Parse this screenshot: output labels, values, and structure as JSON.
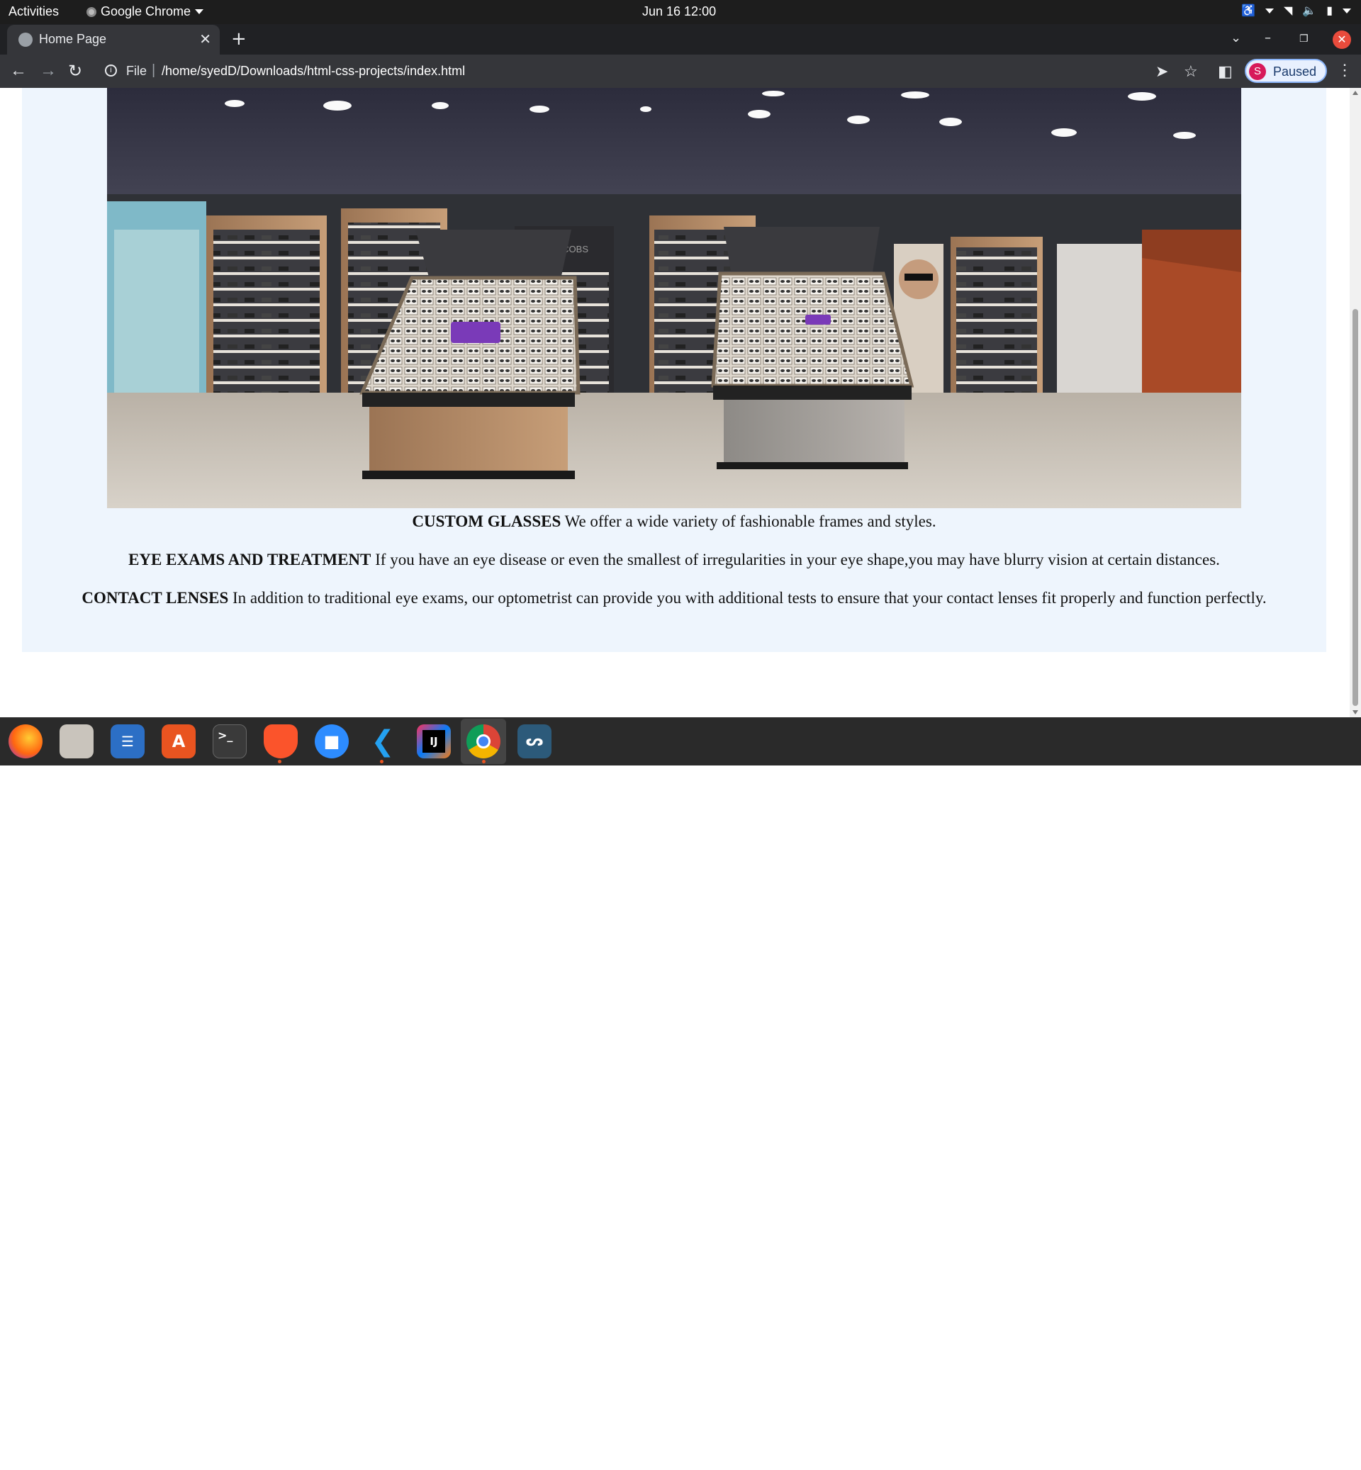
{
  "system_bar": {
    "activities": "Activities",
    "app_name": "Google Chrome",
    "clock": "Jun 16  12:00"
  },
  "browser": {
    "tab_title": "Home Page",
    "new_tab": "+",
    "url_scheme": "File",
    "url_path": "/home/syedD/Downloads/html-css-projects/index.html",
    "profile_initial": "S",
    "profile_status": "Paused"
  },
  "page": {
    "store_image_alt": "JOHN JACOBS",
    "services": [
      {
        "title": "CUSTOM GLASSES",
        "text": "We offer a wide variety of fashionable frames and styles."
      },
      {
        "title": "EYE EXAMS AND TREATMENT",
        "text": "If you have an eye disease or even the smallest of irregularities in your eye shape,you may have blurry vision at certain distances."
      },
      {
        "title": "CONTACT LENSES",
        "text": "In addition to traditional eye exams, our optometrist can provide you with additional tests to ensure that your contact lenses fit properly and function perfectly."
      }
    ]
  },
  "dock": {
    "items": [
      "firefox-icon",
      "files-icon",
      "text-editor-icon",
      "software-center-icon",
      "terminal-icon",
      "brave-icon",
      "zoom-icon",
      "vscode-icon",
      "intellij-icon",
      "chrome-icon",
      "mysql-workbench-icon"
    ],
    "terminal_glyph": ">_",
    "intellij_glyph": "IJ"
  },
  "colors": {
    "page_card": "#eef5fd",
    "profile_avatar": "#d7195a",
    "close_button": "#e94b3c"
  }
}
